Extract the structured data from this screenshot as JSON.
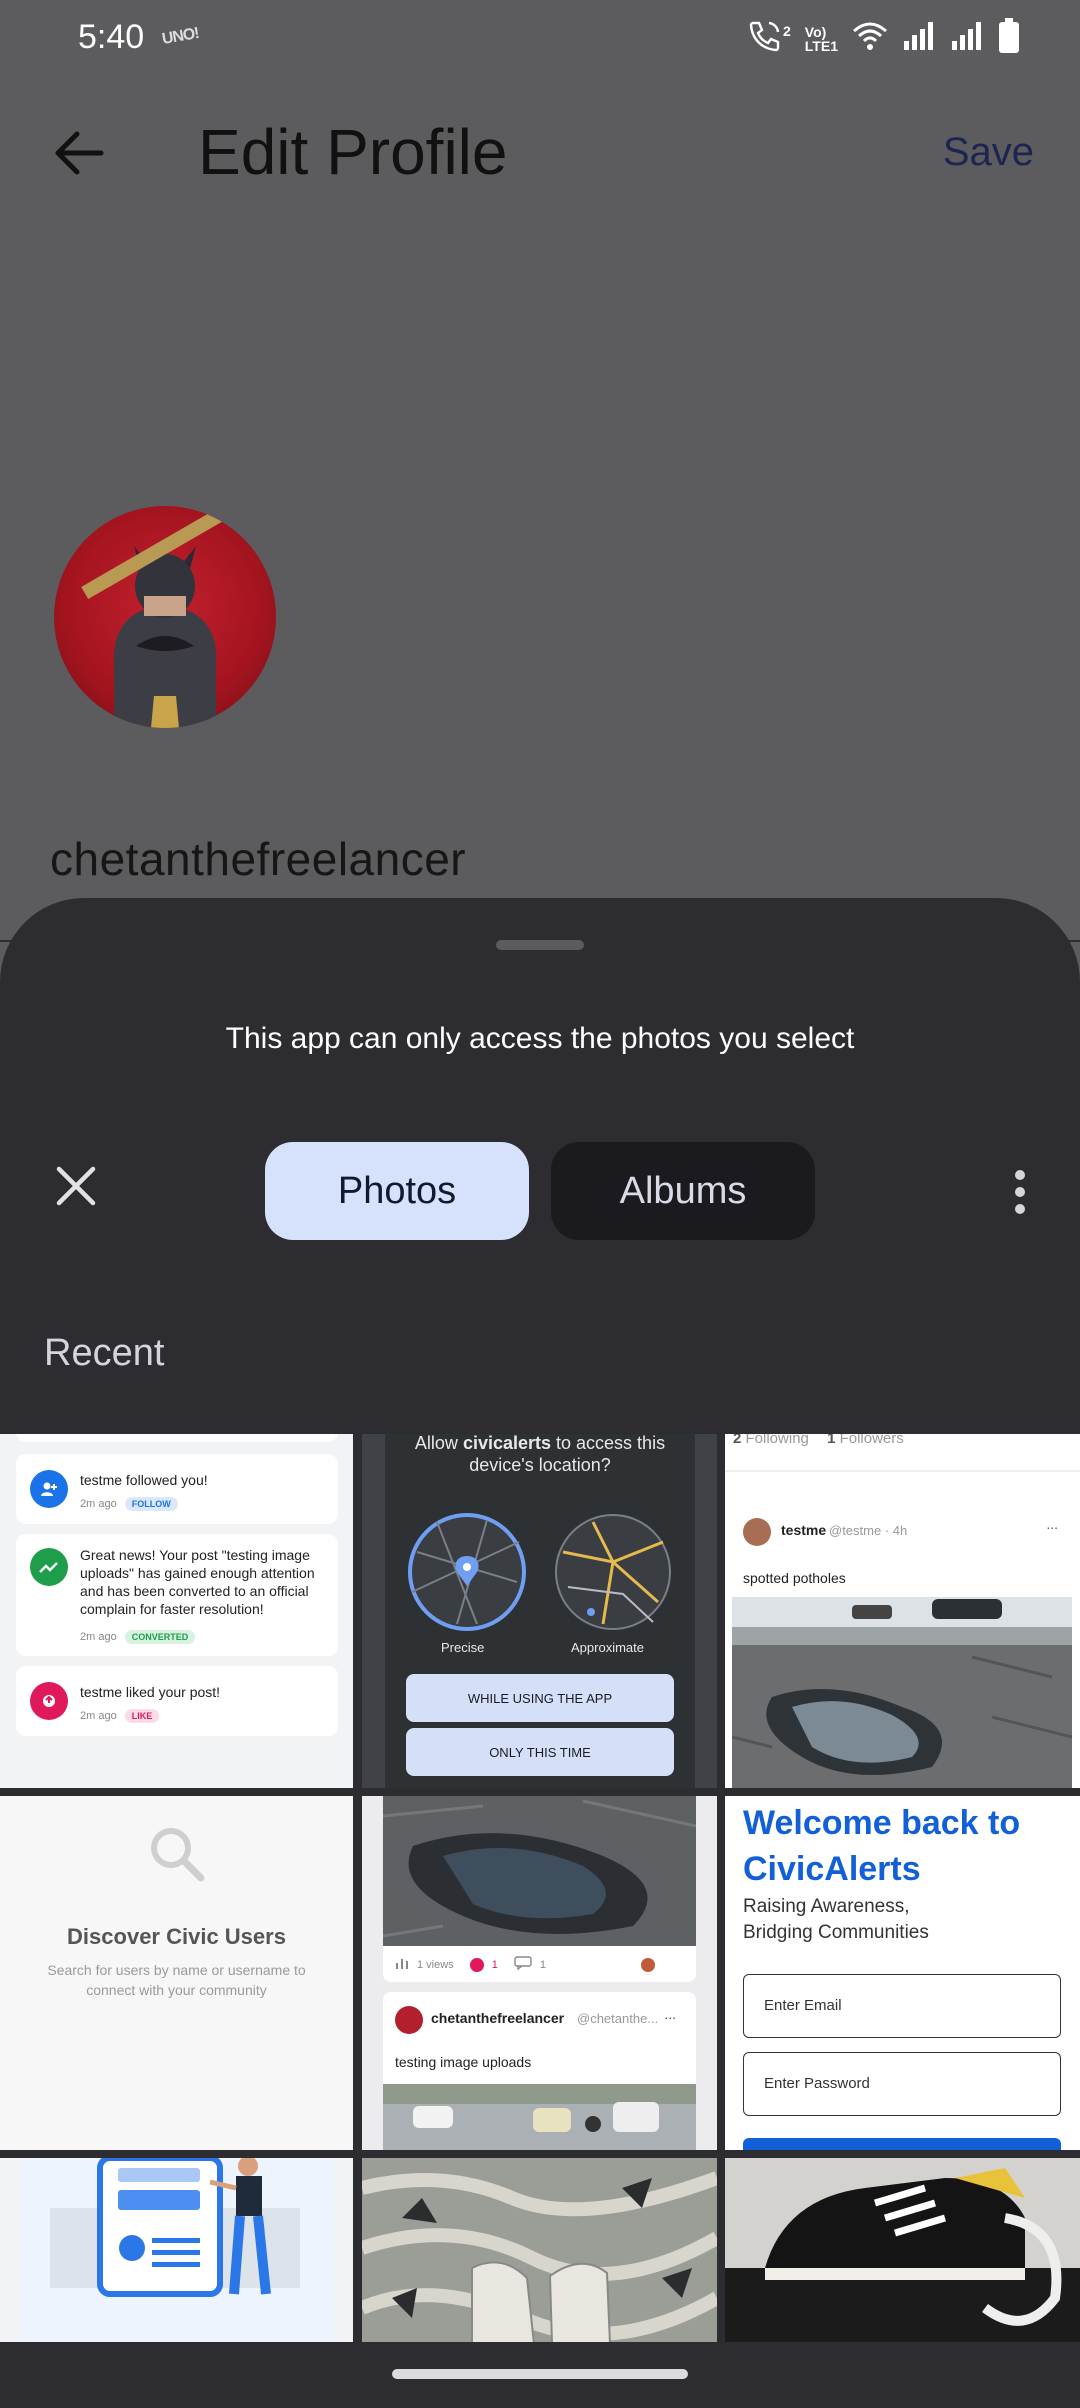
{
  "status_bar": {
    "time": "5:40",
    "notification_label": "UNO!",
    "network_label_1": "Vo)",
    "network_label_2": "LTE1",
    "call_sim": "2"
  },
  "header": {
    "title": "Edit Profile",
    "save_label": "Save"
  },
  "profile": {
    "username": "chetanthefreelancer"
  },
  "picker": {
    "message": "This app can only access the photos you select",
    "tabs": [
      {
        "label": "Photos",
        "selected": true
      },
      {
        "label": "Albums",
        "selected": false
      }
    ],
    "section_label": "Recent"
  },
  "thumbnails": {
    "notifications": {
      "items": [
        {
          "text": "testme followed you!",
          "time": "2m ago",
          "badge": "FOLLOW",
          "color": "#1a73e8"
        },
        {
          "text": "Great news! Your post \"testing image uploads\" has gained enough attention and has been converted to an official complain for faster resolution!",
          "time": "2m ago",
          "badge": "CONVERTED",
          "color": "#1e9e4a"
        },
        {
          "text": "testme liked your post!",
          "time": "2m ago",
          "badge": "LIKE",
          "color": "#e0195c"
        }
      ]
    },
    "location_dialog": {
      "question_pre": "Allow ",
      "question_app": "civicalerts",
      "question_post": " to access this device's location?",
      "precise": "Precise",
      "approximate": "Approximate",
      "button_1": "WHILE USING THE APP",
      "button_2": "ONLY THIS TIME"
    },
    "post": {
      "following_count": "2",
      "following_label": "Following",
      "followers_count": "1",
      "followers_label": "Followers",
      "author": "testme",
      "handle_time": "@testme · 4h",
      "text": "spotted potholes",
      "menu": "..."
    },
    "discover": {
      "title": "Discover Civic Users",
      "subtitle": "Search for users by name or username to connect with your community"
    },
    "pothole_post": {
      "views": "1 views",
      "likes": "1",
      "comments": "1",
      "author": "chetanthefreelancer",
      "handle": "@chetanthe...",
      "text": "testing image uploads",
      "menu": "..."
    },
    "login": {
      "title": "Welcome back to CivicAlerts",
      "subtitle_1": "Raising Awareness,",
      "subtitle_2": "Bridging Communities",
      "email_placeholder": "Enter Email",
      "password_placeholder": "Enter Password"
    }
  },
  "colors": {
    "scrim": "#5c5c5f",
    "sheet": "#2d2d31",
    "selected_tab": "#d6e2fc",
    "unselected_tab": "#1b1b1f",
    "brand_blue": "#1160d8"
  }
}
